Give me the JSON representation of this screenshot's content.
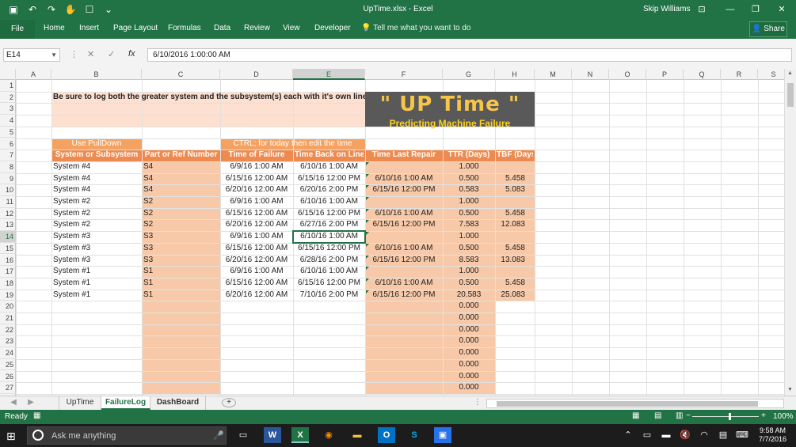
{
  "window": {
    "title": "UpTime.xlsx - Excel",
    "user": "Skip Williams"
  },
  "ribbon": {
    "tabs": [
      "File",
      "Home",
      "Insert",
      "Page Layout",
      "Formulas",
      "Data",
      "Review",
      "View",
      "Developer"
    ],
    "tell_me": "Tell me what you want to do",
    "share": "Share"
  },
  "formula_bar": {
    "name_box": "E14",
    "fx": "fx",
    "formula": "6/10/2016  1:00:00 AM"
  },
  "columns": [
    "A",
    "B",
    "C",
    "D",
    "E",
    "F",
    "G",
    "H",
    "M",
    "N",
    "O",
    "P",
    "Q",
    "R",
    "S"
  ],
  "rows": [
    "1",
    "2",
    "3",
    "4",
    "5",
    "6",
    "7",
    "8",
    "9",
    "10",
    "11",
    "12",
    "13",
    "14",
    "15",
    "16",
    "17",
    "18",
    "19",
    "20",
    "21",
    "22",
    "23",
    "24",
    "25",
    "26",
    "27"
  ],
  "selected": {
    "col": "E",
    "row": "14"
  },
  "sheet": {
    "note": "Be sure to log both the greater system and the subsystem(s) each with it's own line",
    "banner_title": "\" UP Time \"",
    "banner_subtitle": "Predicting Machine Failure",
    "hint_pulldown": "Use PullDown",
    "hint_ctrl": "CTRL; for today then edit the time",
    "headers": [
      "System or Subsystem",
      "Part or Ref  Number",
      "Time of Failure",
      "Time Back on Line",
      "Time Last Repair",
      "TTR (Days)",
      "TBF (Days)"
    ],
    "data": [
      [
        "System #4",
        "S4",
        "6/9/16 1:00 AM",
        "6/10/16 1:00 AM",
        "",
        "1.000",
        ""
      ],
      [
        "System #4",
        "S4",
        "6/15/16 12:00 AM",
        "6/15/16 12:00 PM",
        "6/10/16 1:00 AM",
        "0.500",
        "5.458"
      ],
      [
        "System #4",
        "S4",
        "6/20/16 12:00 AM",
        "6/20/16 2:00 PM",
        "6/15/16 12:00 PM",
        "0.583",
        "5.083"
      ],
      [
        "System #2",
        "S2",
        "6/9/16 1:00 AM",
        "6/10/16 1:00 AM",
        "",
        "1.000",
        ""
      ],
      [
        "System #2",
        "S2",
        "6/15/16 12:00 AM",
        "6/15/16 12:00 PM",
        "6/10/16 1:00 AM",
        "0.500",
        "5.458"
      ],
      [
        "System #2",
        "S2",
        "6/20/16 12:00 AM",
        "6/27/16 2:00 PM",
        "6/15/16 12:00 PM",
        "7.583",
        "12.083"
      ],
      [
        "System #3",
        "S3",
        "6/9/16 1:00 AM",
        "6/10/16 1:00 AM",
        "",
        "1.000",
        ""
      ],
      [
        "System #3",
        "S3",
        "6/15/16 12:00 AM",
        "6/15/16 12:00 PM",
        "6/10/16 1:00 AM",
        "0.500",
        "5.458"
      ],
      [
        "System #3",
        "S3",
        "6/20/16 12:00 AM",
        "6/28/16 2:00 PM",
        "6/15/16 12:00 PM",
        "8.583",
        "13.083"
      ],
      [
        "System #1",
        "S1",
        "6/9/16 1:00 AM",
        "6/10/16 1:00 AM",
        "",
        "1.000",
        ""
      ],
      [
        "System #1",
        "S1",
        "6/15/16 12:00 AM",
        "6/15/16 12:00 PM",
        "6/10/16 1:00 AM",
        "0.500",
        "5.458"
      ],
      [
        "System #1",
        "S1",
        "6/20/16 12:00 AM",
        "7/10/16 2:00 PM",
        "6/15/16 12:00 PM",
        "20.583",
        "25.083"
      ]
    ],
    "empty_ttr": [
      "0.000",
      "0.000",
      "0.000",
      "0.000",
      "0.000",
      "0.000",
      "0.000",
      "0.000"
    ]
  },
  "sheet_tabs": [
    "UpTime",
    "FailureLog",
    "DashBoard"
  ],
  "active_sheet": "FailureLog",
  "status": {
    "ready": "Ready",
    "zoom": "100%"
  },
  "taskbar": {
    "search_placeholder": "Ask me anything",
    "time": "9:58 AM",
    "date": "7/7/2016"
  },
  "colors": {
    "excel_green": "#217346",
    "header_orange": "#f4a261",
    "light_peach": "#fde0d0",
    "peach": "#f8c9a8",
    "banner_bg": "#595959",
    "banner_text": "#f7c548"
  }
}
